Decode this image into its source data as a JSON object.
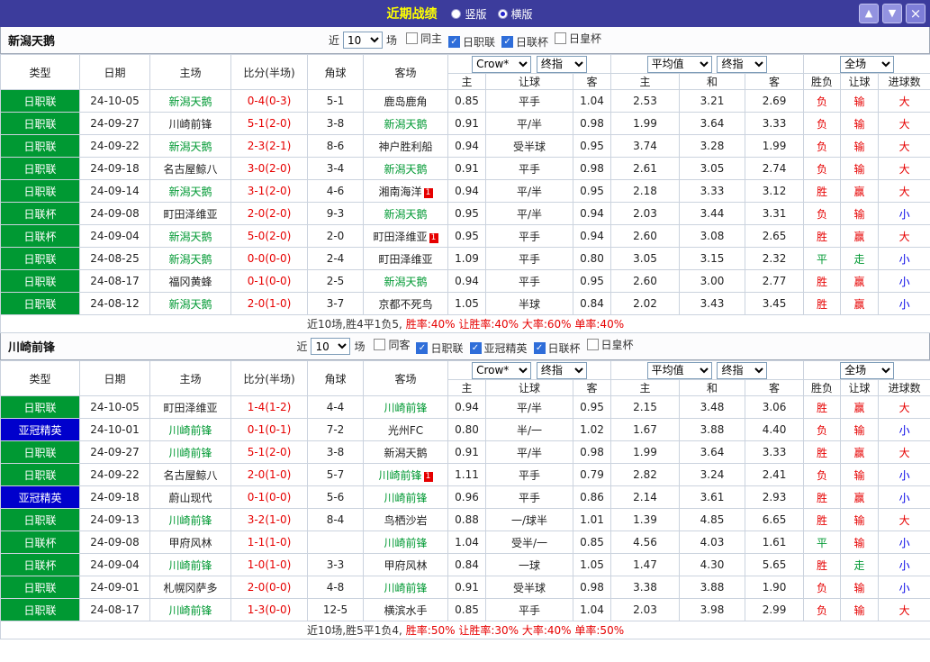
{
  "colors": {
    "titlebar_bg": "#3C3C9C",
    "title_text": "#FFFF00",
    "league_green": "#009933",
    "acl_blue": "#0000CC",
    "score_red": "#E60000",
    "result_red": "#E60000",
    "result_green": "#009933",
    "result_blue": "#0000E6",
    "checkbox_blue": "#2E6DD9"
  },
  "titlebar": {
    "title": "近期战绩",
    "icons": {
      "up": "▲",
      "down": "▼",
      "close": "×"
    },
    "view_options": [
      {
        "label": "竖版",
        "selected": false
      },
      {
        "label": "横版",
        "selected": true
      }
    ]
  },
  "filter_labels": {
    "near": "近",
    "games": "场"
  },
  "table_header": {
    "type": "类型",
    "date": "日期",
    "home": "主场",
    "score": "比分(半场)",
    "corners": "角球",
    "away": "客场",
    "odds_select": "Crow*",
    "odds_close": "终指",
    "odds_cols": [
      "主",
      "让球",
      "客"
    ],
    "avg_select": "平均值",
    "avg_close": "终指",
    "avg_cols": [
      "主",
      "和",
      "客"
    ],
    "scope_select": "全场",
    "result_cols": [
      "胜负",
      "让球",
      "进球数"
    ]
  },
  "sections": [
    {
      "team": "新潟天鹅",
      "count": "10",
      "checkboxes": [
        {
          "label": "同主",
          "checked": false
        },
        {
          "label": "日职联",
          "checked": true
        },
        {
          "label": "日联杯",
          "checked": true
        },
        {
          "label": "日皇杯",
          "checked": false
        }
      ],
      "rows": [
        {
          "league": "日职联",
          "league_style": "green",
          "date": "24-10-05",
          "home": "新潟天鹅",
          "home_focus": true,
          "home_card": "",
          "score": "0-4(0-3)",
          "corners": "5-1",
          "away": "鹿岛鹿角",
          "away_focus": false,
          "away_card": "",
          "odds": [
            "0.85",
            "平手",
            "1.04"
          ],
          "avg": [
            "2.53",
            "3.21",
            "2.69"
          ],
          "results": [
            [
              "负",
              "red"
            ],
            [
              "输",
              "red"
            ],
            [
              "大",
              "red"
            ]
          ]
        },
        {
          "league": "日职联",
          "league_style": "green",
          "date": "24-09-27",
          "home": "川崎前锋",
          "home_focus": false,
          "home_card": "",
          "score": "5-1(2-0)",
          "corners": "3-8",
          "away": "新潟天鹅",
          "away_focus": true,
          "away_card": "",
          "odds": [
            "0.91",
            "平/半",
            "0.98"
          ],
          "avg": [
            "1.99",
            "3.64",
            "3.33"
          ],
          "results": [
            [
              "负",
              "red"
            ],
            [
              "输",
              "red"
            ],
            [
              "大",
              "red"
            ]
          ]
        },
        {
          "league": "日职联",
          "league_style": "green",
          "date": "24-09-22",
          "home": "新潟天鹅",
          "home_focus": true,
          "home_card": "",
          "score": "2-3(2-1)",
          "corners": "8-6",
          "away": "神户胜利船",
          "away_focus": false,
          "away_card": "",
          "odds": [
            "0.94",
            "受半球",
            "0.95"
          ],
          "avg": [
            "3.74",
            "3.28",
            "1.99"
          ],
          "results": [
            [
              "负",
              "red"
            ],
            [
              "输",
              "red"
            ],
            [
              "大",
              "red"
            ]
          ]
        },
        {
          "league": "日职联",
          "league_style": "green",
          "date": "24-09-18",
          "home": "名古屋鲸八",
          "home_focus": false,
          "home_card": "",
          "score": "3-0(2-0)",
          "corners": "3-4",
          "away": "新潟天鹅",
          "away_focus": true,
          "away_card": "",
          "odds": [
            "0.91",
            "平手",
            "0.98"
          ],
          "avg": [
            "2.61",
            "3.05",
            "2.74"
          ],
          "results": [
            [
              "负",
              "red"
            ],
            [
              "输",
              "red"
            ],
            [
              "大",
              "red"
            ]
          ]
        },
        {
          "league": "日职联",
          "league_style": "green",
          "date": "24-09-14",
          "home": "新潟天鹅",
          "home_focus": true,
          "home_card": "",
          "score": "3-1(2-0)",
          "corners": "4-6",
          "away": "湘南海洋",
          "away_focus": false,
          "away_card": "1",
          "odds": [
            "0.94",
            "平/半",
            "0.95"
          ],
          "avg": [
            "2.18",
            "3.33",
            "3.12"
          ],
          "results": [
            [
              "胜",
              "red"
            ],
            [
              "赢",
              "red"
            ],
            [
              "大",
              "red"
            ]
          ]
        },
        {
          "league": "日联杯",
          "league_style": "green",
          "date": "24-09-08",
          "home": "町田泽维亚",
          "home_focus": false,
          "home_card": "",
          "score": "2-0(2-0)",
          "corners": "9-3",
          "away": "新潟天鹅",
          "away_focus": true,
          "away_card": "",
          "odds": [
            "0.95",
            "平/半",
            "0.94"
          ],
          "avg": [
            "2.03",
            "3.44",
            "3.31"
          ],
          "results": [
            [
              "负",
              "red"
            ],
            [
              "输",
              "red"
            ],
            [
              "小",
              "blue"
            ]
          ]
        },
        {
          "league": "日联杯",
          "league_style": "green",
          "date": "24-09-04",
          "home": "新潟天鹅",
          "home_focus": true,
          "home_card": "",
          "score": "5-0(2-0)",
          "corners": "2-0",
          "away": "町田泽维亚",
          "away_focus": false,
          "away_card": "1",
          "odds": [
            "0.95",
            "平手",
            "0.94"
          ],
          "avg": [
            "2.60",
            "3.08",
            "2.65"
          ],
          "results": [
            [
              "胜",
              "red"
            ],
            [
              "赢",
              "red"
            ],
            [
              "大",
              "red"
            ]
          ]
        },
        {
          "league": "日职联",
          "league_style": "green",
          "date": "24-08-25",
          "home": "新潟天鹅",
          "home_focus": true,
          "home_card": "",
          "score": "0-0(0-0)",
          "corners": "2-4",
          "away": "町田泽维亚",
          "away_focus": false,
          "away_card": "",
          "odds": [
            "1.09",
            "平手",
            "0.80"
          ],
          "avg": [
            "3.05",
            "3.15",
            "2.32"
          ],
          "results": [
            [
              "平",
              "green"
            ],
            [
              "走",
              "green"
            ],
            [
              "小",
              "blue"
            ]
          ]
        },
        {
          "league": "日职联",
          "league_style": "green",
          "date": "24-08-17",
          "home": "福冈黄蜂",
          "home_focus": false,
          "home_card": "",
          "score": "0-1(0-0)",
          "corners": "2-5",
          "away": "新潟天鹅",
          "away_focus": true,
          "away_card": "",
          "odds": [
            "0.94",
            "平手",
            "0.95"
          ],
          "avg": [
            "2.60",
            "3.00",
            "2.77"
          ],
          "results": [
            [
              "胜",
              "red"
            ],
            [
              "赢",
              "red"
            ],
            [
              "小",
              "blue"
            ]
          ]
        },
        {
          "league": "日职联",
          "league_style": "green",
          "date": "24-08-12",
          "home": "新潟天鹅",
          "home_focus": true,
          "home_card": "",
          "score": "2-0(1-0)",
          "corners": "3-7",
          "away": "京都不死鸟",
          "away_focus": false,
          "away_card": "",
          "odds": [
            "1.05",
            "半球",
            "0.84"
          ],
          "avg": [
            "2.02",
            "3.43",
            "3.45"
          ],
          "results": [
            [
              "胜",
              "red"
            ],
            [
              "赢",
              "red"
            ],
            [
              "小",
              "blue"
            ]
          ]
        }
      ],
      "summary": {
        "record": "近10场,胜4平1负5,",
        "stats": "胜率:40% 让胜率:40% 大率:60% 单率:40%"
      }
    },
    {
      "team": "川崎前锋",
      "count": "10",
      "checkboxes": [
        {
          "label": "同客",
          "checked": false
        },
        {
          "label": "日职联",
          "checked": true
        },
        {
          "label": "亚冠精英",
          "checked": true
        },
        {
          "label": "日联杯",
          "checked": true
        },
        {
          "label": "日皇杯",
          "checked": false
        }
      ],
      "rows": [
        {
          "league": "日职联",
          "league_style": "green",
          "date": "24-10-05",
          "home": "町田泽维亚",
          "home_focus": false,
          "home_card": "",
          "score": "1-4(1-2)",
          "corners": "4-4",
          "away": "川崎前锋",
          "away_focus": true,
          "away_card": "",
          "odds": [
            "0.94",
            "平/半",
            "0.95"
          ],
          "avg": [
            "2.15",
            "3.48",
            "3.06"
          ],
          "results": [
            [
              "胜",
              "red"
            ],
            [
              "赢",
              "red"
            ],
            [
              "大",
              "red"
            ]
          ]
        },
        {
          "league": "亚冠精英",
          "league_style": "blue",
          "date": "24-10-01",
          "home": "川崎前锋",
          "home_focus": true,
          "home_card": "",
          "score": "0-1(0-1)",
          "corners": "7-2",
          "away": "光州FC",
          "away_focus": false,
          "away_card": "",
          "odds": [
            "0.80",
            "半/一",
            "1.02"
          ],
          "avg": [
            "1.67",
            "3.88",
            "4.40"
          ],
          "results": [
            [
              "负",
              "red"
            ],
            [
              "输",
              "red"
            ],
            [
              "小",
              "blue"
            ]
          ]
        },
        {
          "league": "日职联",
          "league_style": "green",
          "date": "24-09-27",
          "home": "川崎前锋",
          "home_focus": true,
          "home_card": "",
          "score": "5-1(2-0)",
          "corners": "3-8",
          "away": "新潟天鹅",
          "away_focus": false,
          "away_card": "",
          "odds": [
            "0.91",
            "平/半",
            "0.98"
          ],
          "avg": [
            "1.99",
            "3.64",
            "3.33"
          ],
          "results": [
            [
              "胜",
              "red"
            ],
            [
              "赢",
              "red"
            ],
            [
              "大",
              "red"
            ]
          ]
        },
        {
          "league": "日职联",
          "league_style": "green",
          "date": "24-09-22",
          "home": "名古屋鲸八",
          "home_focus": false,
          "home_card": "",
          "score": "2-0(1-0)",
          "corners": "5-7",
          "away": "川崎前锋",
          "away_focus": true,
          "away_card": "1",
          "odds": [
            "1.11",
            "平手",
            "0.79"
          ],
          "avg": [
            "2.82",
            "3.24",
            "2.41"
          ],
          "results": [
            [
              "负",
              "red"
            ],
            [
              "输",
              "red"
            ],
            [
              "小",
              "blue"
            ]
          ]
        },
        {
          "league": "亚冠精英",
          "league_style": "blue",
          "date": "24-09-18",
          "home": "蔚山现代",
          "home_focus": false,
          "home_card": "",
          "score": "0-1(0-0)",
          "corners": "5-6",
          "away": "川崎前锋",
          "away_focus": true,
          "away_card": "",
          "odds": [
            "0.96",
            "平手",
            "0.86"
          ],
          "avg": [
            "2.14",
            "3.61",
            "2.93"
          ],
          "results": [
            [
              "胜",
              "red"
            ],
            [
              "赢",
              "red"
            ],
            [
              "小",
              "blue"
            ]
          ]
        },
        {
          "league": "日职联",
          "league_style": "green",
          "date": "24-09-13",
          "home": "川崎前锋",
          "home_focus": true,
          "home_card": "",
          "score": "3-2(1-0)",
          "corners": "8-4",
          "away": "鸟栖沙岩",
          "away_focus": false,
          "away_card": "",
          "odds": [
            "0.88",
            "一/球半",
            "1.01"
          ],
          "avg": [
            "1.39",
            "4.85",
            "6.65"
          ],
          "results": [
            [
              "胜",
              "red"
            ],
            [
              "输",
              "red"
            ],
            [
              "大",
              "red"
            ]
          ]
        },
        {
          "league": "日联杯",
          "league_style": "green",
          "date": "24-09-08",
          "home": "甲府风林",
          "home_focus": false,
          "home_card": "",
          "score": "1-1(1-0)",
          "corners": "",
          "away": "川崎前锋",
          "away_focus": true,
          "away_card": "",
          "odds": [
            "1.04",
            "受半/一",
            "0.85"
          ],
          "avg": [
            "4.56",
            "4.03",
            "1.61"
          ],
          "results": [
            [
              "平",
              "green"
            ],
            [
              "输",
              "red"
            ],
            [
              "小",
              "blue"
            ]
          ]
        },
        {
          "league": "日联杯",
          "league_style": "green",
          "date": "24-09-04",
          "home": "川崎前锋",
          "home_focus": true,
          "home_card": "",
          "score": "1-0(1-0)",
          "corners": "3-3",
          "away": "甲府风林",
          "away_focus": false,
          "away_card": "",
          "odds": [
            "0.84",
            "一球",
            "1.05"
          ],
          "avg": [
            "1.47",
            "4.30",
            "5.65"
          ],
          "results": [
            [
              "胜",
              "red"
            ],
            [
              "走",
              "green"
            ],
            [
              "小",
              "blue"
            ]
          ]
        },
        {
          "league": "日职联",
          "league_style": "green",
          "date": "24-09-01",
          "home": "札幌冈萨多",
          "home_focus": false,
          "home_card": "",
          "score": "2-0(0-0)",
          "corners": "4-8",
          "away": "川崎前锋",
          "away_focus": true,
          "away_card": "",
          "odds": [
            "0.91",
            "受半球",
            "0.98"
          ],
          "avg": [
            "3.38",
            "3.88",
            "1.90"
          ],
          "results": [
            [
              "负",
              "red"
            ],
            [
              "输",
              "red"
            ],
            [
              "小",
              "blue"
            ]
          ]
        },
        {
          "league": "日职联",
          "league_style": "green",
          "date": "24-08-17",
          "home": "川崎前锋",
          "home_focus": true,
          "home_card": "",
          "score": "1-3(0-0)",
          "corners": "12-5",
          "away": "横滨水手",
          "away_focus": false,
          "away_card": "",
          "odds": [
            "0.85",
            "平手",
            "1.04"
          ],
          "avg": [
            "2.03",
            "3.98",
            "2.99"
          ],
          "results": [
            [
              "负",
              "red"
            ],
            [
              "输",
              "red"
            ],
            [
              "大",
              "red"
            ]
          ]
        }
      ],
      "summary": {
        "record": "近10场,胜5平1负4,",
        "stats": "胜率:50% 让胜率:30% 大率:40% 单率:50%"
      }
    }
  ]
}
